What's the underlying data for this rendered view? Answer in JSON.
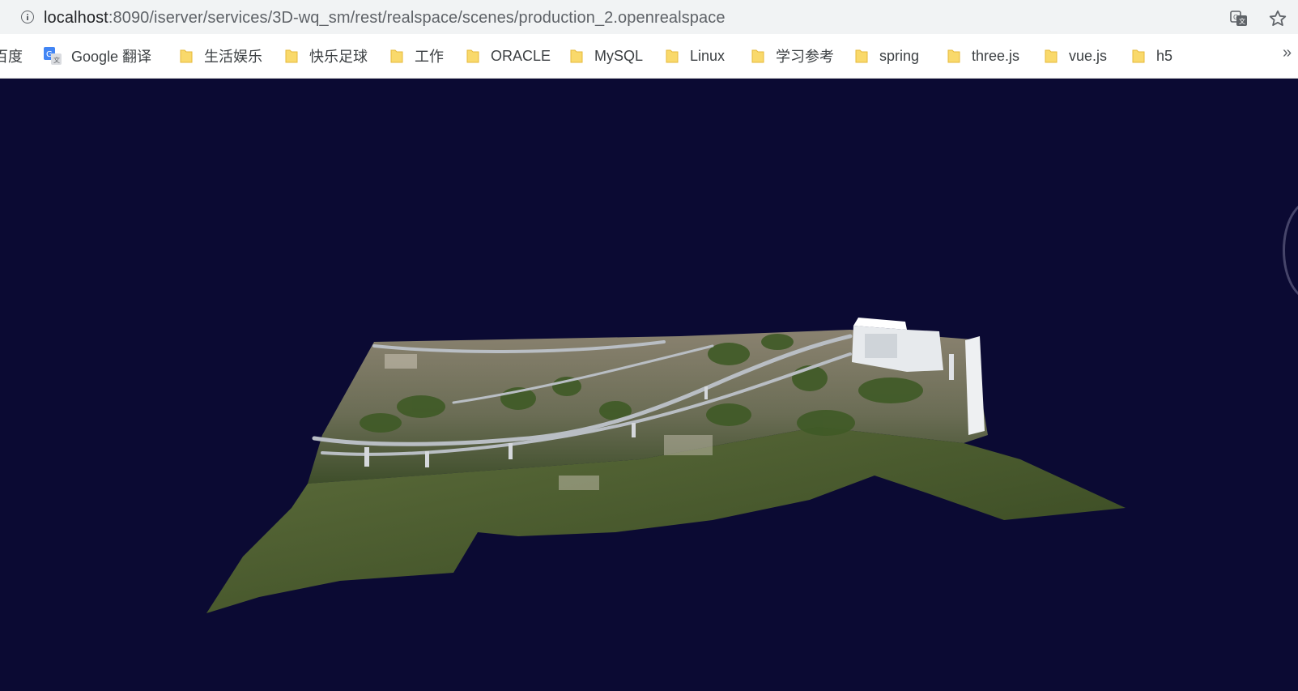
{
  "browser": {
    "url_host": "localhost",
    "url_rest": ":8090/iserver/services/3D-wq_sm/rest/realspace/scenes/production_2.openrealspace"
  },
  "bookmarks": [
    {
      "label": "百度",
      "icon": "none"
    },
    {
      "label": "Google 翻译",
      "icon": "google-translate-icon"
    },
    {
      "label": "生活娱乐",
      "icon": "folder-icon"
    },
    {
      "label": "快乐足球",
      "icon": "folder-icon"
    },
    {
      "label": "工作",
      "icon": "folder-icon"
    },
    {
      "label": "ORACLE",
      "icon": "folder-icon"
    },
    {
      "label": "MySQL",
      "icon": "folder-icon"
    },
    {
      "label": "Linux",
      "icon": "folder-icon"
    },
    {
      "label": "学习参考",
      "icon": "folder-icon"
    },
    {
      "label": "spring",
      "icon": "folder-icon"
    },
    {
      "label": "three.js",
      "icon": "folder-icon"
    },
    {
      "label": "vue.js",
      "icon": "folder-icon"
    },
    {
      "label": "h5",
      "icon": "folder-icon"
    }
  ],
  "overflow_label": "»",
  "colors": {
    "scene_bg": "#0b0a33",
    "folder": "#f9d96b",
    "terrain": "#4a5a30"
  }
}
